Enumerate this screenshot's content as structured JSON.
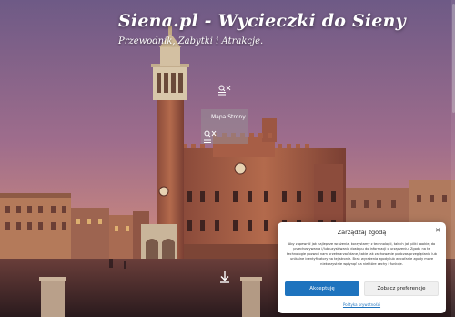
{
  "header": {
    "site_title": "Siena.pl - Wycieczki do Sieny",
    "tagline": "Przewodnik, Zabytki i Atrakcje."
  },
  "nav": {
    "menu_link": "Mapa Strony",
    "search_icon": "search-icon",
    "close_icon": "close-icon",
    "menu_icon": "hamburger-icon"
  },
  "hero": {
    "image": "Torre del Mangia and Palazzo Pubblico at dusk, Piazza del Campo",
    "scroll_icon": "arrow-down-icon"
  },
  "consent": {
    "title": "Zarządzaj zgodą",
    "text": "Aby zapewnić jak najlepsze wrażenia, korzystamy z technologii, takich jak pliki cookie, do przechowywania i/lub uzyskiwania dostępu do informacji o urządzeniu. Zgoda na te technologie pozwoli nam przetwarzać dane, takie jak zachowanie podczas przeglądania lub unikalne identyfikatory na tej stronie. Brak wyrażenia zgody lub wycofanie zgody może niekorzystnie wpłynąć na niektóre cechy i funkcje.",
    "accept_label": "Akceptuję",
    "preferences_label": "Zobacz preferencje",
    "policy_link": "Polityka prywatności"
  },
  "colors": {
    "sky_top": "#6e5a86",
    "sky_mid": "#a56f8a",
    "sky_bottom": "#d48f7a",
    "brick": "#a85d44",
    "accept_button": "#1e73be"
  }
}
